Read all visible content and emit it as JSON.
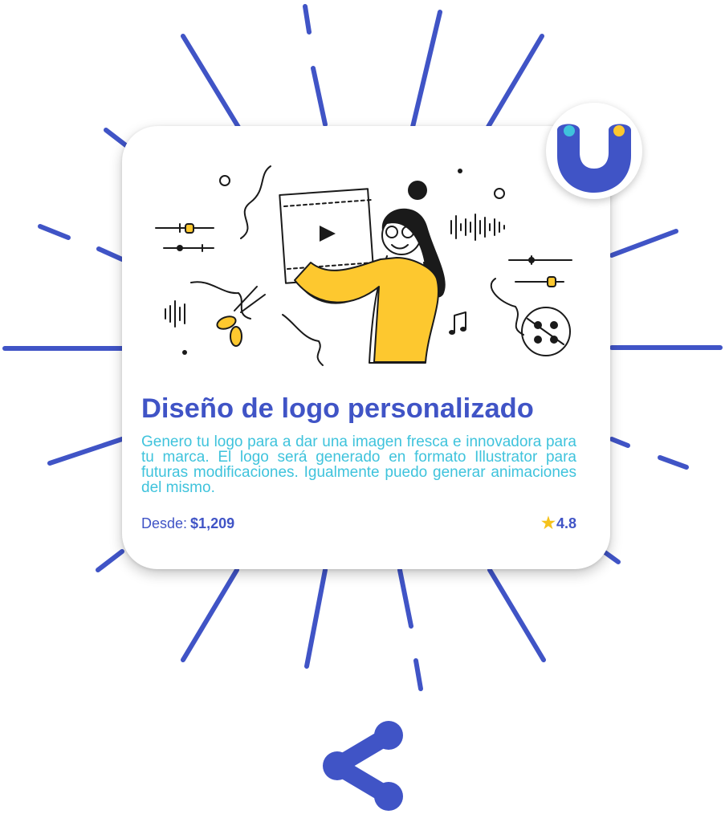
{
  "card": {
    "title": "Diseño de logo personalizado",
    "description": "Genero tu logo para a dar una imagen fresca e innovadora para tu marca. El logo será generado en formato Illustrator para futuras modificaciones. Igualmente puedo generar animaciones del mismo.",
    "price_label": "Desde:",
    "price_value": "$1,209",
    "rating": "4.8",
    "rating_icon": "star-icon",
    "illustration": "woman-holding-video-frame-illustration"
  },
  "brand": {
    "logo_icon": "brand-smile-logo-icon"
  },
  "actions": {
    "share_icon": "share-icon"
  },
  "colors": {
    "accent_blue": "#4054c6",
    "description_cyan": "#3fc3dc",
    "star_yellow": "#f5c21b",
    "illustration_yellow": "#fdc82f"
  }
}
